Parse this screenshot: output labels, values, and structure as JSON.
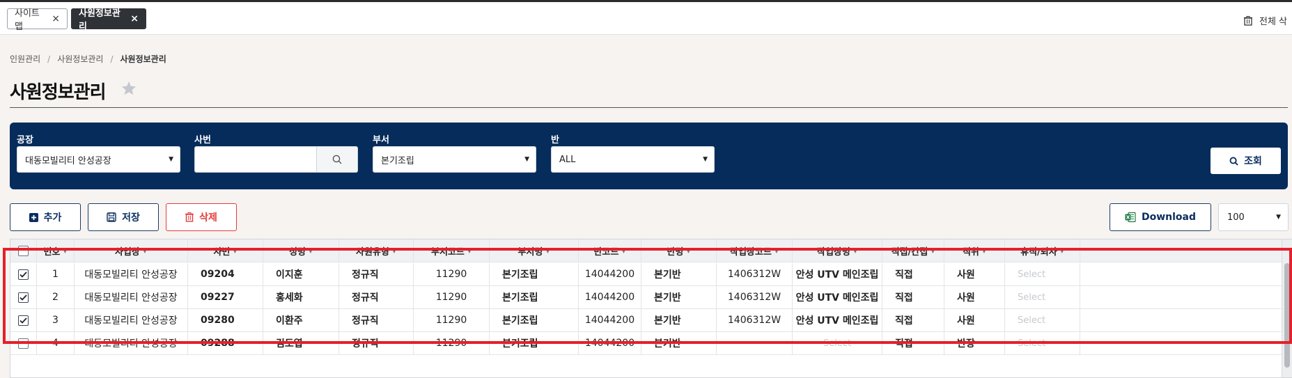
{
  "tabs": [
    {
      "label": "사이트맵",
      "close": "×"
    },
    {
      "label": "사원정보관리",
      "close": "×"
    }
  ],
  "header_actions": {
    "delete_all": "전체 삭"
  },
  "breadcrumb": [
    "인원관리",
    "사원정보관리",
    "사원정보관리"
  ],
  "breadcrumb_sep": "/",
  "page_title": "사원정보관리",
  "filters": {
    "factory": {
      "label": "공장",
      "value": "대동모빌리티 안성공장"
    },
    "emp_no": {
      "label": "사번",
      "value": ""
    },
    "department": {
      "label": "부서",
      "value": "본기조립"
    },
    "team": {
      "label": "반",
      "value": "ALL"
    },
    "query_label": "조회"
  },
  "actions": {
    "add": "추가",
    "save": "저장",
    "delete": "삭제",
    "download": "Download",
    "page_size": "100"
  },
  "grid": {
    "columns": [
      "번호",
      "사업장",
      "사번",
      "성명",
      "사원유형",
      "부서코드",
      "부서명",
      "반코드",
      "반명",
      "작업장코드",
      "작업장명",
      "직접/간접",
      "직위",
      "휴직/퇴사"
    ],
    "rows": [
      {
        "checked": true,
        "cells": [
          "1",
          "대동모빌리티 안성공장",
          "09204",
          "이지훈",
          "정규직",
          "11290",
          "본기조립",
          "14044200",
          "본기반",
          "1406312W",
          "안성 UTV 메인조립",
          "직접",
          "사원",
          "Select"
        ]
      },
      {
        "checked": true,
        "cells": [
          "2",
          "대동모빌리티 안성공장",
          "09227",
          "홍세화",
          "정규직",
          "11290",
          "본기조립",
          "14044200",
          "본기반",
          "1406312W",
          "안성 UTV 메인조립",
          "직접",
          "사원",
          "Select"
        ]
      },
      {
        "checked": true,
        "cells": [
          "3",
          "대동모빌리티 안성공장",
          "09280",
          "이환주",
          "정규직",
          "11290",
          "본기조립",
          "14044200",
          "본기반",
          "1406312W",
          "안성 UTV 메인조립",
          "직접",
          "사원",
          "Select"
        ]
      },
      {
        "checked": false,
        "cells": [
          "4",
          "대동모빌리티 안성공장",
          "09288",
          "김도엽",
          "정규직",
          "11290",
          "본기조립",
          "14044200",
          "본기반",
          "",
          "Select",
          "직접",
          "반장",
          "Select"
        ]
      }
    ]
  },
  "colors": {
    "panel": "#062c5b",
    "accent": "#0a2d5e",
    "danger": "#e53b3b",
    "highlight": "#e4202a",
    "excel": "#1d7a45"
  }
}
